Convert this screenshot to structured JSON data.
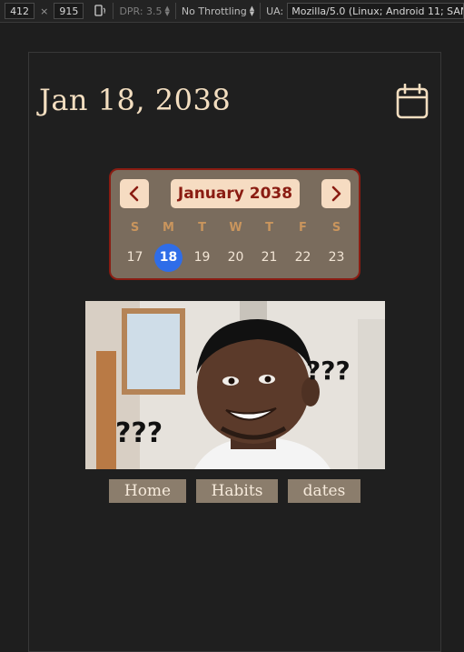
{
  "devtools": {
    "width": "412",
    "times": "×",
    "height": "915",
    "dpr": "DPR: 3.5",
    "throttling": "No Throttling",
    "ua_label": "UA:",
    "ua_value": "Mozilla/5.0 (Linux; Android 11; SAM"
  },
  "header": {
    "date_title": "Jan 18, 2038",
    "calendar_icon": "calendar-icon"
  },
  "calendar": {
    "month_label": "January 2038",
    "weekdays": [
      "S",
      "M",
      "T",
      "W",
      "T",
      "F",
      "S"
    ],
    "days": [
      "17",
      "18",
      "19",
      "20",
      "21",
      "22",
      "23"
    ],
    "selected_day": "18",
    "colors": {
      "background": "#7a6c5d",
      "border": "#8a1c12",
      "pill": "#f6dcc2",
      "selected": "#2f6de8"
    }
  },
  "meme": {
    "caption_left": "???",
    "caption_right": "???"
  },
  "nav": {
    "home": "Home",
    "habits": "Habits",
    "dates": "dates"
  }
}
